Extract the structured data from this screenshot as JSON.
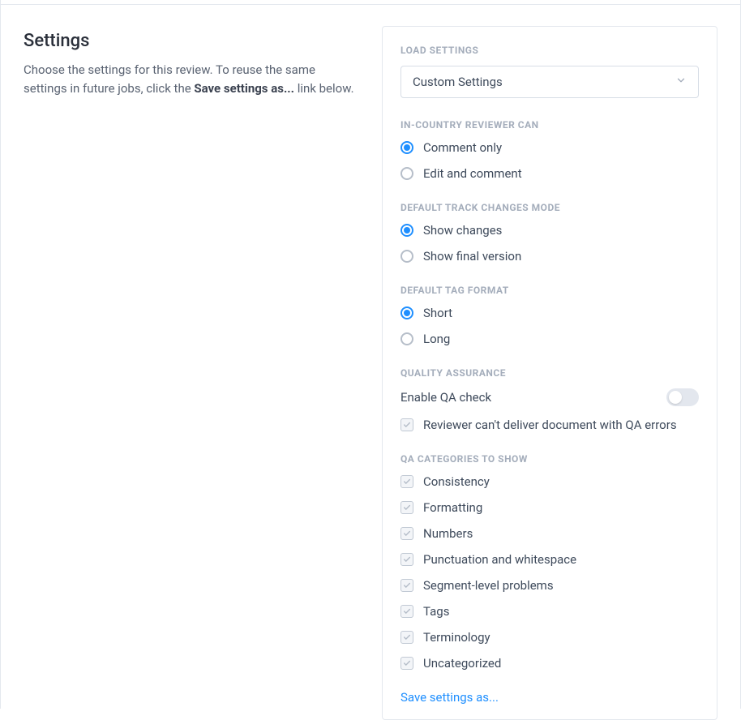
{
  "header": {
    "title": "Settings",
    "description_pre": "Choose the settings for this review. To reuse the same settings in future jobs, click the ",
    "description_bold": "Save settings as...",
    "description_post": " link below."
  },
  "panel": {
    "load_settings": {
      "label": "LOAD SETTINGS",
      "selected": "Custom Settings"
    },
    "reviewer_can": {
      "label": "IN-COUNTRY REVIEWER CAN",
      "options": [
        {
          "id": "comment-only",
          "label": "Comment only",
          "checked": true
        },
        {
          "id": "edit-and-comment",
          "label": "Edit and comment",
          "checked": false
        }
      ]
    },
    "track_changes": {
      "label": "DEFAULT TRACK CHANGES MODE",
      "options": [
        {
          "id": "show-changes",
          "label": "Show changes",
          "checked": true
        },
        {
          "id": "show-final",
          "label": "Show final version",
          "checked": false
        }
      ]
    },
    "tag_format": {
      "label": "DEFAULT TAG FORMAT",
      "options": [
        {
          "id": "short",
          "label": "Short",
          "checked": true
        },
        {
          "id": "long",
          "label": "Long",
          "checked": false
        }
      ]
    },
    "qa": {
      "label": "QUALITY ASSURANCE",
      "enable_label": "Enable QA check",
      "enabled": false,
      "block_delivery": {
        "label": "Reviewer can't deliver document with QA errors",
        "checked": true
      }
    },
    "qa_categories": {
      "label": "QA CATEGORIES TO SHOW",
      "items": [
        {
          "id": "consistency",
          "label": "Consistency",
          "checked": true
        },
        {
          "id": "formatting",
          "label": "Formatting",
          "checked": true
        },
        {
          "id": "numbers",
          "label": "Numbers",
          "checked": true
        },
        {
          "id": "punctuation",
          "label": "Punctuation and whitespace",
          "checked": true
        },
        {
          "id": "segment-level",
          "label": "Segment-level problems",
          "checked": true
        },
        {
          "id": "tags",
          "label": "Tags",
          "checked": true
        },
        {
          "id": "terminology",
          "label": "Terminology",
          "checked": true
        },
        {
          "id": "uncategorized",
          "label": "Uncategorized",
          "checked": true
        }
      ]
    },
    "save_link": "Save settings as..."
  }
}
